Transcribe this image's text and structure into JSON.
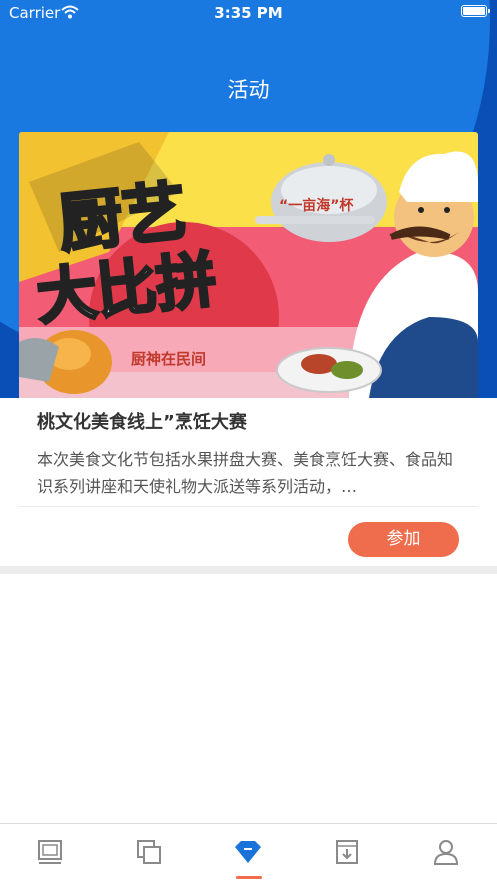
{
  "status_bar": {
    "carrier": "Carrier",
    "time": "3:35 PM"
  },
  "header": {
    "title": "活动"
  },
  "activity_card": {
    "banner": {
      "headline_line1": "厨艺",
      "headline_line2": "大比拼",
      "cup_label": "“一亩海”杯",
      "tagline": "厨神在民间"
    },
    "title": "桃文化美食线上”烹饪大赛",
    "description": "本次美食文化节包括水果拼盘大赛、美食烹饪大赛、食品知识系列讲座和天使礼物大派送等系列活动，…",
    "join_label": "参加"
  },
  "tab_bar": {
    "tabs": [
      {
        "icon": "monitor-icon"
      },
      {
        "icon": "copy-icon"
      },
      {
        "icon": "diamond-icon",
        "active": true
      },
      {
        "icon": "download-box-icon"
      },
      {
        "icon": "user-icon"
      }
    ]
  },
  "colors": {
    "header_dark_blue": "#0a4fb5",
    "header_light_blue": "#1979e0",
    "accent": "#ef6c4c",
    "active_tab": "#1a73d9",
    "inactive_tab": "#8a8a8a"
  }
}
